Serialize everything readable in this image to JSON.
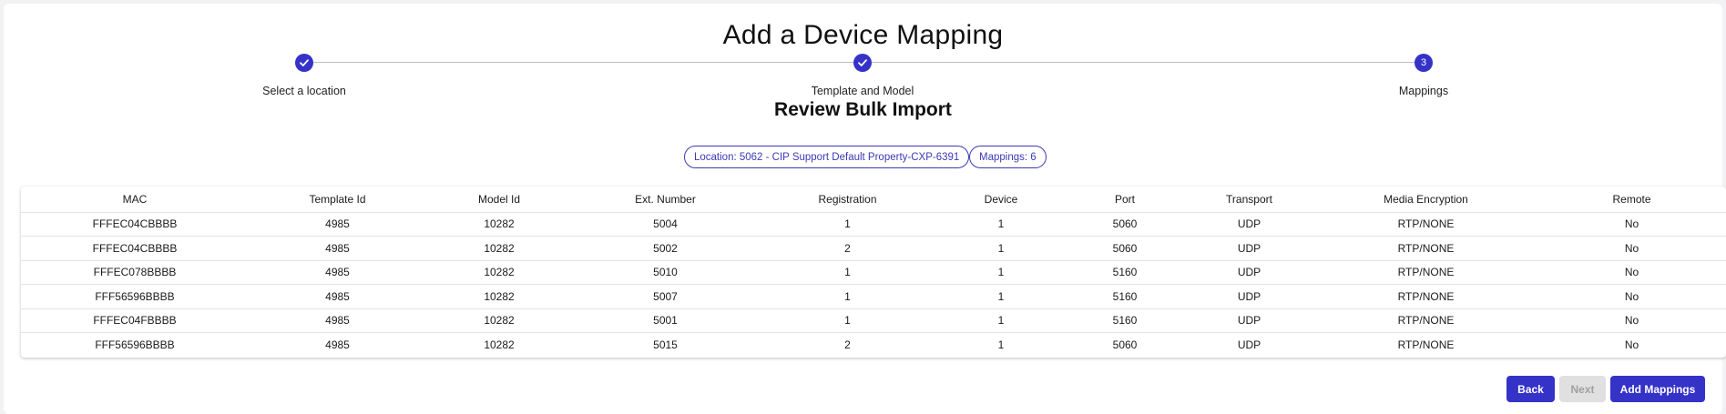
{
  "header": {
    "title": "Add a Device Mapping",
    "subtitle": "Review Bulk Import"
  },
  "stepper": {
    "steps": [
      {
        "label": "Select a location",
        "state": "complete",
        "icon": "check-icon"
      },
      {
        "label": "Template and Model",
        "state": "complete",
        "icon": "check-icon"
      },
      {
        "label": "Mappings",
        "state": "active",
        "number": "3"
      }
    ]
  },
  "chips": {
    "location": "Location: 5062 - CIP Support Default Property-CXP-6391",
    "mappings": "Mappings: 6"
  },
  "table": {
    "columns": [
      "MAC",
      "Template Id",
      "Model Id",
      "Ext. Number",
      "Registration",
      "Device",
      "Port",
      "Transport",
      "Media Encryption",
      "Remote"
    ],
    "rows": [
      [
        "FFFEC04CBBBB",
        "4985",
        "10282",
        "5004",
        "1",
        "1",
        "5060",
        "UDP",
        "RTP/NONE",
        "No"
      ],
      [
        "FFFEC04CBBBB",
        "4985",
        "10282",
        "5002",
        "2",
        "1",
        "5060",
        "UDP",
        "RTP/NONE",
        "No"
      ],
      [
        "FFFEC078BBBB",
        "4985",
        "10282",
        "5010",
        "1",
        "1",
        "5160",
        "UDP",
        "RTP/NONE",
        "No"
      ],
      [
        "FFF56596BBBB",
        "4985",
        "10282",
        "5007",
        "1",
        "1",
        "5160",
        "UDP",
        "RTP/NONE",
        "No"
      ],
      [
        "FFFEC04FBBBB",
        "4985",
        "10282",
        "5001",
        "1",
        "1",
        "5160",
        "UDP",
        "RTP/NONE",
        "No"
      ],
      [
        "FFF56596BBBB",
        "4985",
        "10282",
        "5015",
        "2",
        "1",
        "5060",
        "UDP",
        "RTP/NONE",
        "No"
      ]
    ]
  },
  "actions": {
    "back": "Back",
    "next": "Next",
    "add": "Add Mappings"
  },
  "colors": {
    "primary": "#3532c8",
    "disabled_bg": "#e0e0e0",
    "disabled_text": "#a0a0a0"
  }
}
